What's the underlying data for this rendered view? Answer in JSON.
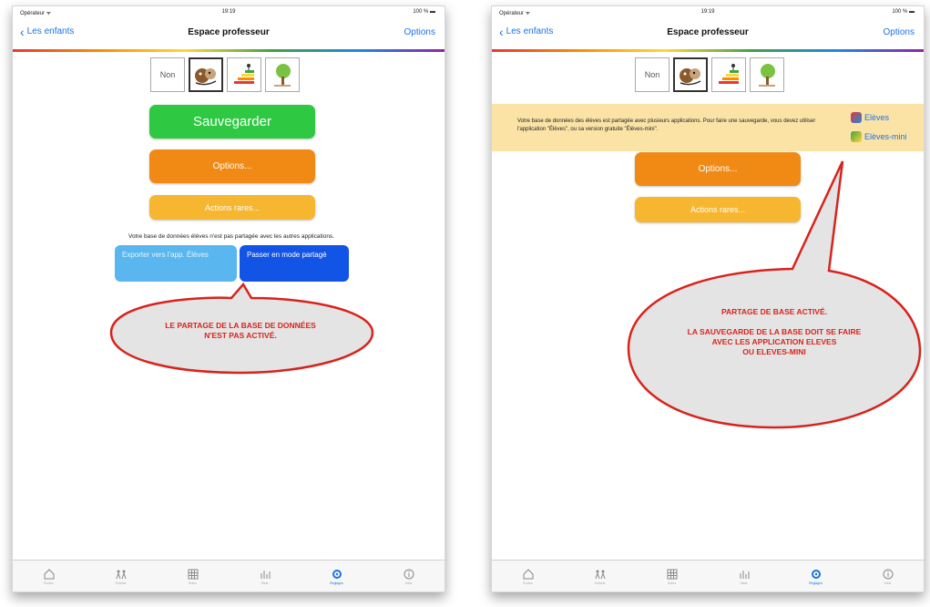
{
  "status_bar": {
    "carrier": "Opérateur ᯤ",
    "time": "19:19",
    "battery": "100 % ▬"
  },
  "nav": {
    "back_label": "Les enfants",
    "title": "Espace professeur",
    "options_label": "Options"
  },
  "icons": {
    "non_label": "Non"
  },
  "left": {
    "save_button": "Sauvegarder",
    "options_button": "Options...",
    "rare_button": "Actions rares...",
    "note": "Votre base de données élèves n'est pas partagée avec les autres applications.",
    "export_button": "Exporter vers l'app. Élèves",
    "shared_button": "Passer en mode partagé",
    "callout": "LE PARTAGE DE LA BASE DE DONNÉES\nN'EST PAS ACTIVÉ."
  },
  "right": {
    "banner_text": "Votre base de données des élèves est partagée avec plusieurs applications. Pour faire une sauvegarde, vous devez utiliser l'application \"Élèves\", ou sa version gratuite \"Élèves-mini\".",
    "app_eleves": "Elèves",
    "app_eleves_mini": "Elèves-mini",
    "options_button": "Options...",
    "rare_button": "Actions rares...",
    "callout": "PARTAGE DE BASE ACTIVÉ.\n\nLA SAUVEGARDE DE LA BASE DOIT SE FAIRE\nAVEC LES APPLICATION ELEVES\nOU ELEVES-MINI"
  },
  "tabs": [
    {
      "label": "Écoles",
      "icon": "home-icon"
    },
    {
      "label": "Enfants",
      "icon": "children-icon"
    },
    {
      "label": "Notes",
      "icon": "grid-icon"
    },
    {
      "label": "Stats",
      "icon": "chart-icon"
    },
    {
      "label": "Réglages",
      "icon": "gear-icon"
    },
    {
      "label": "Infos",
      "icon": "info-icon"
    }
  ],
  "colors": {
    "accent": "#1a73e8",
    "green": "#2fc843",
    "orange": "#f18a14",
    "yellow": "#f6b62f",
    "callout_red": "#d8231d",
    "banner": "#fbe3a6"
  }
}
